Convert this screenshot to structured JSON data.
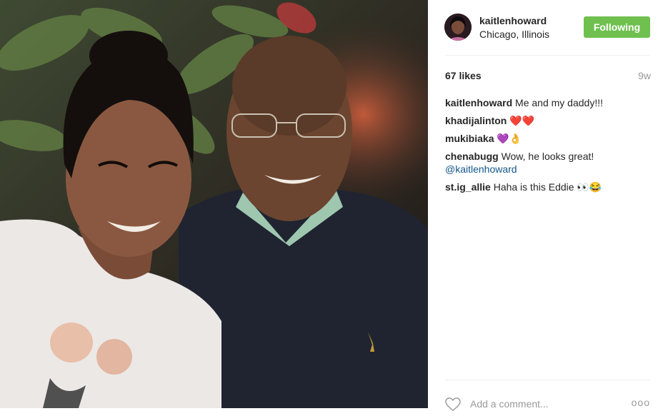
{
  "post": {
    "username": "kaitlenhoward",
    "location": "Chicago, Illinois",
    "follow_label": "Following",
    "likes": "67 likes",
    "age": "9w"
  },
  "comments": [
    {
      "user": "kaitlenhoward",
      "text": "Me and my daddy!!!"
    },
    {
      "user": "khadijalinton",
      "text": "❤️❤️"
    },
    {
      "user": "mukibiaka",
      "text": "💜👌"
    },
    {
      "user": "chenabugg",
      "text": "Wow, he looks great!",
      "mention": "@kaitlenhoward"
    },
    {
      "user": "st.ig_allie",
      "text": "Haha is this Eddie 👀😂"
    }
  ],
  "add_comment": {
    "placeholder": "Add a comment...",
    "more_label": "ooo"
  },
  "icons": {
    "like": "heart-icon",
    "more": "more-options-icon"
  },
  "colors": {
    "follow_button": "#70c050",
    "mention": "#125688"
  }
}
